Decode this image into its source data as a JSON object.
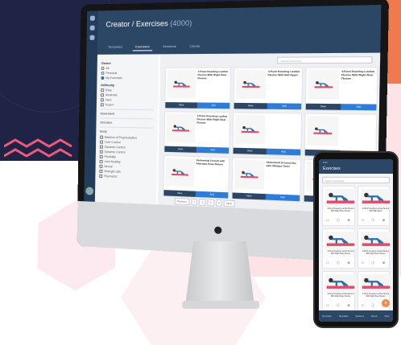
{
  "desktop": {
    "page_title": "Creator / Exercises",
    "page_count": "(4000)",
    "tabs": [
      "Templates",
      "Exercises",
      "Sessions",
      "Clients"
    ],
    "search_placeholder": "Search exercises",
    "filters": {
      "owner_heading": "Owner",
      "owner_options": [
        "All",
        "Personal",
        "My Exercises"
      ],
      "difficulty_heading": "Difficulty",
      "difficulty_options": [
        "Easy",
        "Moderate",
        "Hard",
        "Expert"
      ],
      "groups": [
        "Movement",
        "Direction",
        "Body"
      ],
      "body_items": [
        "Balance of Proprioception",
        "Core Control",
        "Dynamic Control",
        "Dynamic Control",
        "Flexibility",
        "Joint Mobility",
        "Neural",
        "Strength Lifts",
        "Plyometric"
      ]
    },
    "cards": [
      {
        "title": "4-Point Kneeling Lumbar Flexion With Right Rear Flexion",
        "desc": "",
        "btn_left": "View",
        "btn_right": "Add"
      },
      {
        "title": "4-Point Kneeling Lumbar Flexion With Ball Aggro",
        "desc": "",
        "btn_left": "View",
        "btn_right": "Add"
      },
      {
        "title": "4-Point Kneeling Lumbar Flexion With Right Rear Flexion",
        "desc": "",
        "btn_left": "View",
        "btn_right": "Add"
      },
      {
        "title": "4-Point Kneeling Lumbar Flexion With Right Rear Flexion",
        "desc": "",
        "btn_left": "View",
        "btn_right": "Add"
      },
      {
        "title": "",
        "desc": "",
        "btn_left": "View",
        "btn_right": "Add"
      },
      {
        "title": "",
        "desc": "",
        "btn_left": "View",
        "btn_right": "Add"
      },
      {
        "title": "Abdominal Crunch with Alternate Knee Raises",
        "desc": "",
        "btn_left": "View",
        "btn_right": "Add"
      },
      {
        "title": "Abdominal Ground Abs with Oblique Twist",
        "desc": "",
        "btn_left": "View",
        "btn_right": "Add"
      },
      {
        "title": "",
        "desc": "",
        "btn_left": "View",
        "btn_right": "Add"
      }
    ],
    "pager": [
      "Previous",
      "1",
      "2",
      "3",
      "4",
      "Next"
    ]
  },
  "mobile": {
    "status": "9:41",
    "title": "Exercises",
    "search_placeholder": "Search exercises",
    "cards": [
      {
        "title": "4-Point Kneeling Lumbar Flexion With Right Rear Flexion"
      },
      {
        "title": "4-Point Kneeling Lumbar Flexion With Ball Aggro"
      },
      {
        "title": "4-Point Kneeling Lumbar Flexion With Right Rear Flexion"
      },
      {
        "title": "4-Point Kneeling Lumbar Flexion With Right Rear Flexion"
      },
      {
        "title": "4-Point Kneeling Lumbar Flexion With Right Rear Flexion"
      },
      {
        "title": "4-Point Kneeling Lumbar Flexion With Right Rear Flexion"
      }
    ],
    "nav": [
      "Exercises",
      "Templates",
      "Sessions",
      "Clients",
      "More"
    ]
  },
  "colors": {
    "navy": "#1f2346",
    "accent_orange": "#ee7a4e",
    "app_blue": "#2c4766",
    "button_blue": "#2f7bd8",
    "pink": "#fde3e6"
  }
}
